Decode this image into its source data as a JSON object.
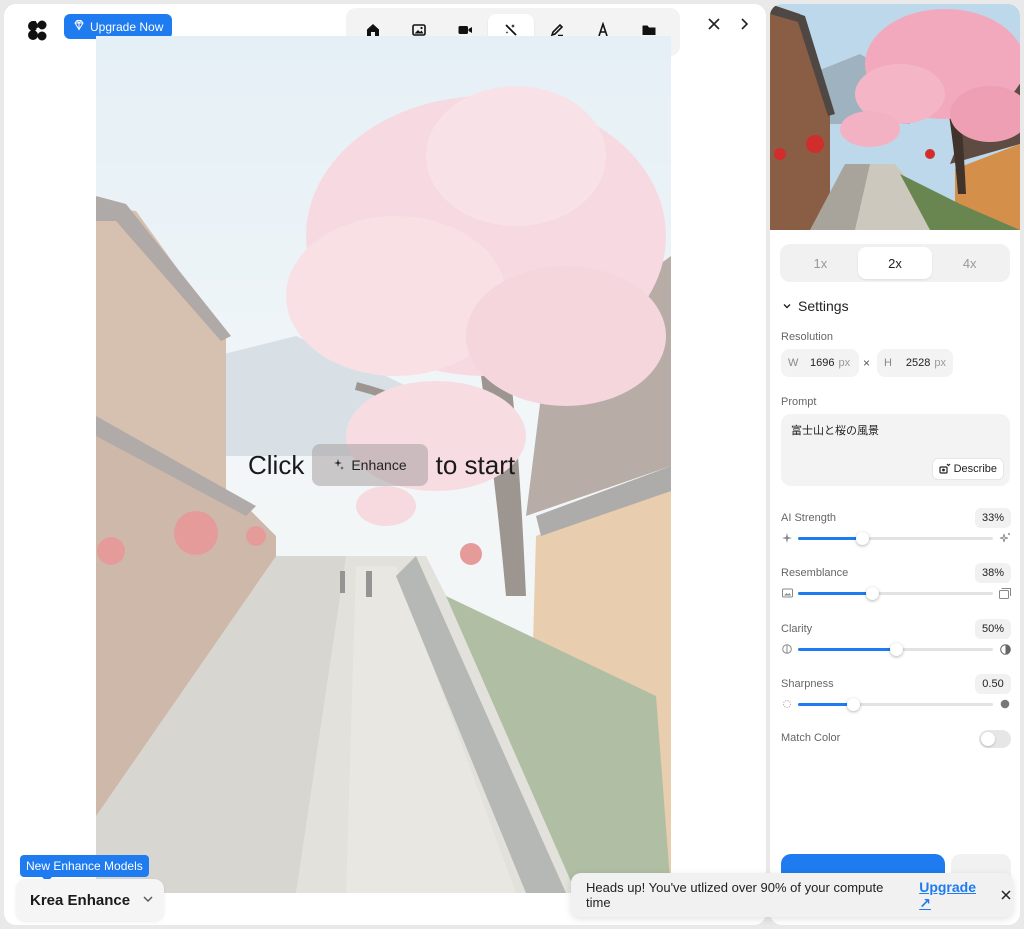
{
  "header": {
    "upgrade_label": "Upgrade Now",
    "tools": [
      {
        "icon": "home-icon",
        "active": false
      },
      {
        "icon": "image-icon",
        "active": false
      },
      {
        "icon": "video-icon",
        "active": false
      },
      {
        "icon": "enhance-wand-icon",
        "active": true
      },
      {
        "icon": "edit-pen-icon",
        "active": false
      },
      {
        "icon": "text-font-icon",
        "active": false
      },
      {
        "icon": "folder-icon",
        "active": false
      }
    ]
  },
  "canvas": {
    "click_text": "Click",
    "enhance_chip_label": "Enhance",
    "to_start_text": "to start"
  },
  "model": {
    "badge": "New Enhance Models",
    "selected": "Krea Enhance"
  },
  "settings": {
    "scales": [
      "1x",
      "2x",
      "4x"
    ],
    "active_scale": "2x",
    "section_title": "Settings",
    "resolution_label": "Resolution",
    "width_key": "W",
    "width_value": "1696",
    "height_key": "H",
    "height_value": "2528",
    "unit": "px",
    "prompt_label": "Prompt",
    "prompt_value": "富士山と桜の風景",
    "describe_label": "Describe",
    "sliders": [
      {
        "label": "AI Strength",
        "value": "33%",
        "fraction": 0.33
      },
      {
        "label": "Resemblance",
        "value": "38%",
        "fraction": 0.38
      },
      {
        "label": "Clarity",
        "value": "50%",
        "fraction": 0.5
      },
      {
        "label": "Sharpness",
        "value": "0.50",
        "fraction": 0.28
      }
    ],
    "match_color_label": "Match Color",
    "match_color_on": false
  },
  "toast": {
    "message": "Heads up! You've utlized over 90% of your compute time",
    "link": "Upgrade ↗"
  },
  "colors": {
    "accent": "#1e7bf0"
  }
}
